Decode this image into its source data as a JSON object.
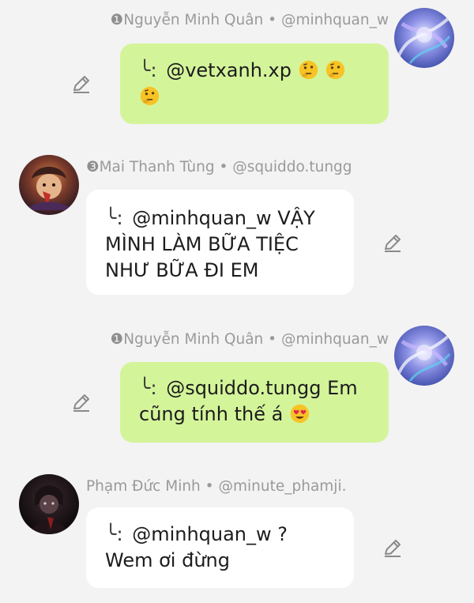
{
  "messages": [
    {
      "side": "right",
      "rank": "❶",
      "author": "Nguyễn Minh Quân",
      "handle": "@minhquan_w",
      "reply_mark": "╰:",
      "text": "@vetxanh.xp",
      "emoji": [
        "thinking-face",
        "thinking-face",
        "thinking-face"
      ]
    },
    {
      "side": "left",
      "rank": "❸",
      "author": "Mai Thanh Tùng",
      "handle": "@squiddo.tungg",
      "reply_mark": "╰:",
      "text": "@minhquan_w VẬY MÌNH LÀM BỮA TIỆC NHƯ BỮA ĐI EM"
    },
    {
      "side": "right",
      "rank": "❶",
      "author": "Nguyễn Minh Quân",
      "handle": "@minhquan_w",
      "reply_mark": "╰:",
      "text": "@squiddo.tungg Em cũng tính thế á",
      "emoji": [
        "heart-eyes-face"
      ]
    },
    {
      "side": "left",
      "rank": "",
      "author": "Phạm Đức Minh",
      "handle": "@minute_phamji.",
      "reply_mark": "╰:",
      "text": "@minhquan_w ? Wem ơi đừng"
    }
  ],
  "separator": " • ",
  "colors": {
    "background": "#f3f3f3",
    "bubble_own": "#d4f49a",
    "bubble_other": "#ffffff",
    "meta_text": "#9a9a9a"
  },
  "icons": {
    "edit": "pencil-edit-icon"
  }
}
